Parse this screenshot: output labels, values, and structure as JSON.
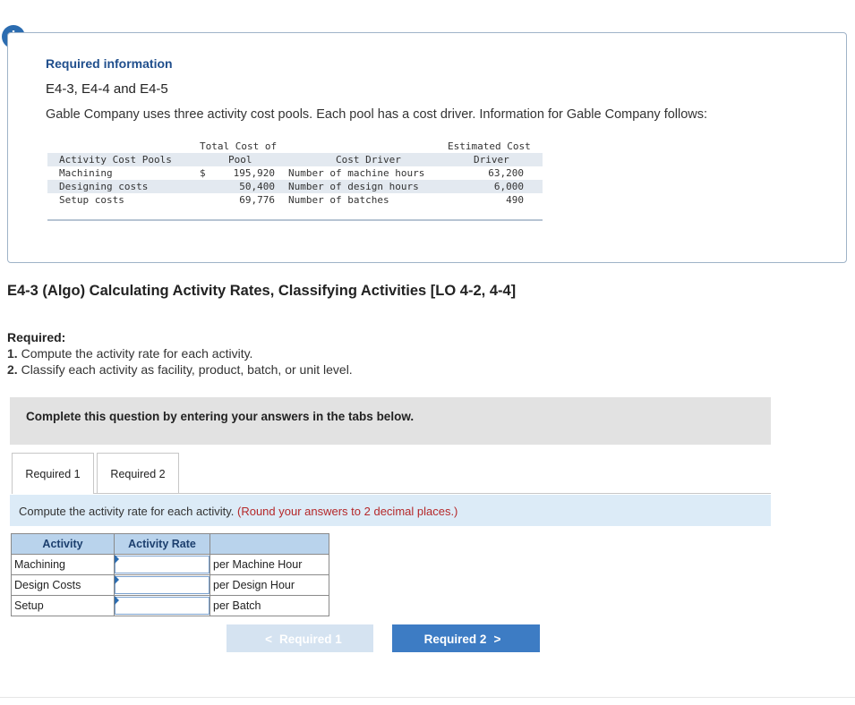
{
  "alert": {
    "symbol": "!"
  },
  "info": {
    "heading": "Required information",
    "subtitle": "E4-3, E4-4 and E4-5",
    "text": "Gable Company uses three activity cost pools. Each pool has a cost driver. Information for Gable Company follows:",
    "table": {
      "headers": {
        "activity": "Activity Cost Pools",
        "total_cost_line1": "Total Cost of",
        "total_cost_line2": "Pool",
        "driver": "Cost Driver",
        "estimated_line1": "Estimated Cost",
        "estimated_line2": "Driver"
      },
      "currency": "$",
      "rows": [
        {
          "activity": "Machining",
          "cost": "195,920",
          "driver": "Number of machine hours",
          "estimated": "63,200"
        },
        {
          "activity": "Designing costs",
          "cost": "50,400",
          "driver": "Number of design hours",
          "estimated": "6,000"
        },
        {
          "activity": "Setup costs",
          "cost": "69,776",
          "driver": "Number of batches",
          "estimated": "490"
        }
      ]
    }
  },
  "exercise": {
    "title": "E4-3 (Algo) Calculating Activity Rates, Classifying Activities [LO 4-2, 4-4]",
    "required_label": "Required:",
    "items": [
      {
        "num": "1.",
        "text": "Compute the activity rate for each activity."
      },
      {
        "num": "2.",
        "text": "Classify each activity as facility, product, batch, or unit level."
      }
    ]
  },
  "instruction": "Complete this question by entering your answers in the tabs below.",
  "tabs": [
    "Required 1",
    "Required 2"
  ],
  "prompt": {
    "text": "Compute the activity rate for each activity.",
    "hint": "(Round your answers to 2 decimal places.)"
  },
  "answer_table": {
    "headers": [
      "Activity",
      "Activity Rate",
      ""
    ],
    "rows": [
      {
        "activity": "Machining",
        "rate": "",
        "unit": "per Machine Hour"
      },
      {
        "activity": "Design Costs",
        "rate": "",
        "unit": "per Design Hour"
      },
      {
        "activity": "Setup",
        "rate": "",
        "unit": "per Batch"
      }
    ]
  },
  "nav": {
    "prev_label": "Required 1",
    "next_label": "Required 2",
    "prev_icon": "<",
    "next_icon": ">"
  }
}
